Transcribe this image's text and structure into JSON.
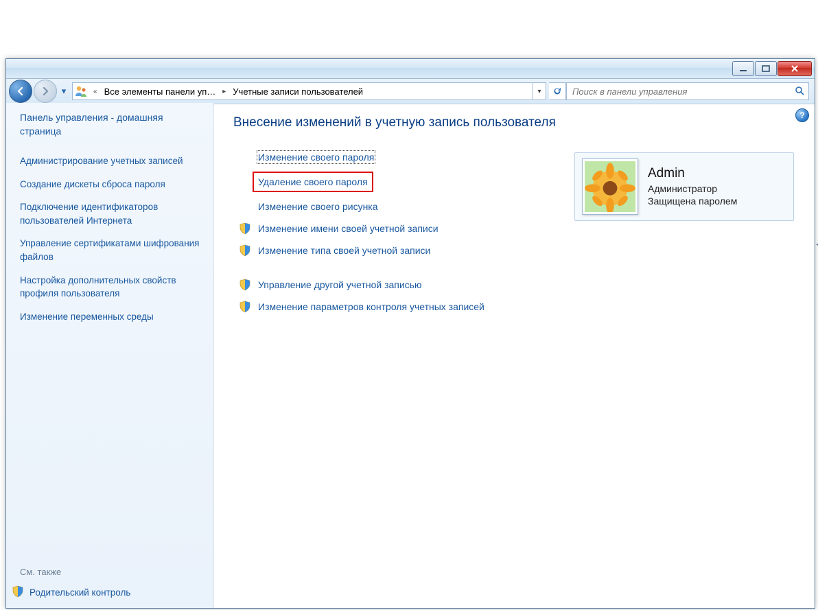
{
  "window": {
    "min": "—",
    "max": "▢",
    "close": "✕"
  },
  "breadcrumb": {
    "segment1": "Все элементы панели уп…",
    "segment2": "Учетные записи пользователей"
  },
  "search": {
    "placeholder": "Поиск в панели управления"
  },
  "sidebar": {
    "home": "Панель управления - домашняя страница",
    "links": [
      "Администрирование учетных записей",
      "Создание дискеты сброса пароля",
      "Подключение идентификаторов пользователей Интернета",
      "Управление сертификатами шифрования файлов",
      "Настройка дополнительных свойств профиля пользователя",
      "Изменение переменных среды"
    ],
    "see_also_label": "См. также",
    "see_also_link": "Родительский контроль"
  },
  "content": {
    "heading": "Внесение изменений в учетную запись пользователя",
    "options": [
      {
        "label": "Изменение своего пароля",
        "shield": false,
        "focused": true,
        "highlight": false
      },
      {
        "label": "Удаление своего пароля",
        "shield": false,
        "focused": false,
        "highlight": true
      },
      {
        "label": "Изменение своего рисунка",
        "shield": false,
        "focused": false,
        "highlight": false
      },
      {
        "label": "Изменение имени своей учетной записи",
        "shield": true,
        "focused": false,
        "highlight": false
      },
      {
        "label": "Изменение типа своей учетной записи",
        "shield": true,
        "focused": false,
        "highlight": false
      }
    ],
    "options2": [
      {
        "label": "Управление другой учетной записью",
        "shield": true
      },
      {
        "label": "Изменение параметров контроля учетных записей",
        "shield": true
      }
    ]
  },
  "user": {
    "name": "Admin",
    "role": "Администратор",
    "protection": "Защищена паролем"
  },
  "help": "?"
}
